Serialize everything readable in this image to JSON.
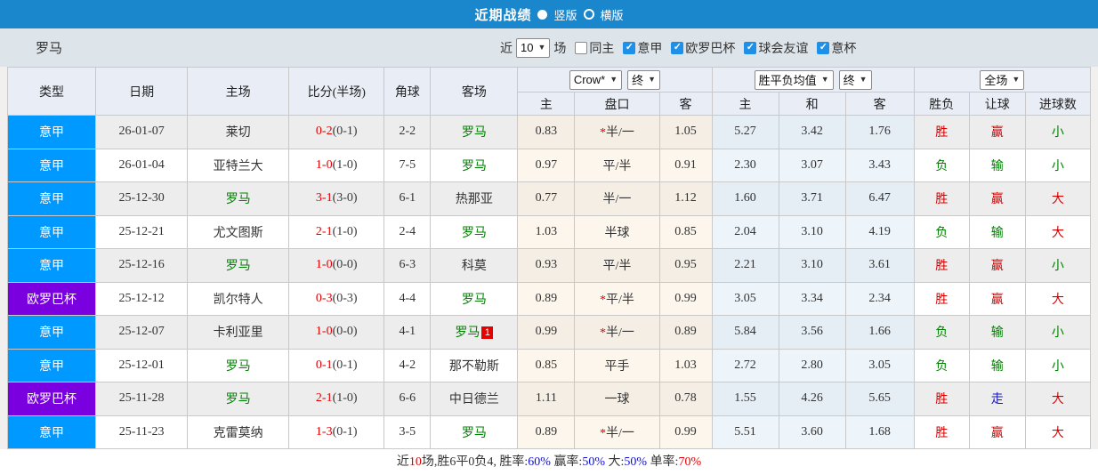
{
  "topbar": {
    "title": "近期战绩",
    "vertical_label": "竖版",
    "horizontal_label": "横版"
  },
  "filter": {
    "team": "罗马",
    "recent_label": "近",
    "count": "10",
    "matches_label": "场",
    "same_home_label": "同主",
    "leagues": [
      "意甲",
      "欧罗巴杯",
      "球会友谊",
      "意杯"
    ]
  },
  "table": {
    "selects": {
      "bookmaker": "Crow*",
      "final_left": "终",
      "avg": "胜平负均值",
      "final_mid": "终",
      "scope": "全场"
    },
    "header_left": [
      "类型",
      "日期",
      "主场",
      "比分(半场)",
      "角球",
      "客场"
    ],
    "header_sub": [
      "主",
      "盘口",
      "客",
      "主",
      "和",
      "客",
      "胜负",
      "让球",
      "进球数"
    ],
    "rows": [
      {
        "comp": "意甲",
        "date": "26-01-07",
        "home": "莱切",
        "score_ft": "0-2",
        "score_ht": "(0-1)",
        "corners": "2-2",
        "away": "罗马",
        "odds_home": "0.83",
        "handicap": "*半/一",
        "odds_away": "1.05",
        "avg_home": "5.27",
        "avg_draw": "3.42",
        "avg_away": "1.76",
        "res_wl": "胜",
        "res_handicap": "赢",
        "res_goals": "小"
      },
      {
        "comp": "意甲",
        "date": "26-01-04",
        "home": "亚特兰大",
        "score_ft": "1-0",
        "score_ht": "(1-0)",
        "corners": "7-5",
        "away": "罗马",
        "odds_home": "0.97",
        "handicap": "平/半",
        "odds_away": "0.91",
        "avg_home": "2.30",
        "avg_draw": "3.07",
        "avg_away": "3.43",
        "res_wl": "负",
        "res_handicap": "输",
        "res_goals": "小"
      },
      {
        "comp": "意甲",
        "date": "25-12-30",
        "home": "罗马",
        "score_ft": "3-1",
        "score_ht": "(3-0)",
        "corners": "6-1",
        "away": "热那亚",
        "odds_home": "0.77",
        "handicap": "半/一",
        "odds_away": "1.12",
        "avg_home": "1.60",
        "avg_draw": "3.71",
        "avg_away": "6.47",
        "res_wl": "胜",
        "res_handicap": "赢",
        "res_goals": "大"
      },
      {
        "comp": "意甲",
        "date": "25-12-21",
        "home": "尤文图斯",
        "score_ft": "2-1",
        "score_ht": "(1-0)",
        "corners": "2-4",
        "away": "罗马",
        "odds_home": "1.03",
        "handicap": "半球",
        "odds_away": "0.85",
        "avg_home": "2.04",
        "avg_draw": "3.10",
        "avg_away": "4.19",
        "res_wl": "负",
        "res_handicap": "输",
        "res_goals": "大"
      },
      {
        "comp": "意甲",
        "date": "25-12-16",
        "home": "罗马",
        "score_ft": "1-0",
        "score_ht": "(0-0)",
        "corners": "6-3",
        "away": "科莫",
        "odds_home": "0.93",
        "handicap": "平/半",
        "odds_away": "0.95",
        "avg_home": "2.21",
        "avg_draw": "3.10",
        "avg_away": "3.61",
        "res_wl": "胜",
        "res_handicap": "赢",
        "res_goals": "小"
      },
      {
        "comp": "欧罗巴杯",
        "date": "25-12-12",
        "home": "凯尔特人",
        "score_ft": "0-3",
        "score_ht": "(0-3)",
        "corners": "4-4",
        "away": "罗马",
        "odds_home": "0.89",
        "handicap": "*平/半",
        "odds_away": "0.99",
        "avg_home": "3.05",
        "avg_draw": "3.34",
        "avg_away": "2.34",
        "res_wl": "胜",
        "res_handicap": "赢",
        "res_goals": "大"
      },
      {
        "comp": "意甲",
        "date": "25-12-07",
        "home": "卡利亚里",
        "score_ft": "1-0",
        "score_ht": "(0-0)",
        "corners": "4-1",
        "away": "罗马",
        "away_card": "1",
        "odds_home": "0.99",
        "handicap": "*半/一",
        "odds_away": "0.89",
        "avg_home": "5.84",
        "avg_draw": "3.56",
        "avg_away": "1.66",
        "res_wl": "负",
        "res_handicap": "输",
        "res_goals": "小"
      },
      {
        "comp": "意甲",
        "date": "25-12-01",
        "home": "罗马",
        "score_ft": "0-1",
        "score_ht": "(0-1)",
        "corners": "4-2",
        "away": "那不勒斯",
        "odds_home": "0.85",
        "handicap": "平手",
        "odds_away": "1.03",
        "avg_home": "2.72",
        "avg_draw": "2.80",
        "avg_away": "3.05",
        "res_wl": "负",
        "res_handicap": "输",
        "res_goals": "小"
      },
      {
        "comp": "欧罗巴杯",
        "date": "25-11-28",
        "home": "罗马",
        "score_ft": "2-1",
        "score_ht": "(1-0)",
        "corners": "6-6",
        "away": "中日德兰",
        "odds_home": "1.11",
        "handicap": "一球",
        "odds_away": "0.78",
        "avg_home": "1.55",
        "avg_draw": "4.26",
        "avg_away": "5.65",
        "res_wl": "胜",
        "res_handicap": "走",
        "res_goals": "大"
      },
      {
        "comp": "意甲",
        "date": "25-11-23",
        "home": "克雷莫纳",
        "score_ft": "1-3",
        "score_ht": "(0-1)",
        "corners": "3-5",
        "away": "罗马",
        "odds_home": "0.89",
        "handicap": "*半/一",
        "odds_away": "0.99",
        "avg_home": "5.51",
        "avg_draw": "3.60",
        "avg_away": "1.68",
        "res_wl": "胜",
        "res_handicap": "赢",
        "res_goals": "大"
      }
    ]
  },
  "result_classes": {
    "胜": "win",
    "负": "lose",
    "赢": "win",
    "输": "lose",
    "走": "draw",
    "大": "win",
    "小": "lose"
  },
  "summary": {
    "p1": "近",
    "count": "10",
    "p2": "场,胜6平0负4, 胜率:",
    "win_rate": "60%",
    "p3": " 赢率:",
    "handicap_rate": "50%",
    "p4": " 大:",
    "big_rate": "50%",
    "p5": " 单率:",
    "single_rate": "70%"
  },
  "colors": {
    "topbar_blue": "#1a87cc",
    "filter_bg": "#dde4ea",
    "header_bg": "#e9eef6",
    "border_gray": "#c9c9c9",
    "zebra_gray": "#ededed",
    "league_italy": "#0099ff",
    "league_europa": "#7a00e0",
    "team_green": "#008000",
    "score_red": "#e60000",
    "star_red": "#e60000",
    "win_red": "#d40000",
    "lose_green": "#008000",
    "draw_blue": "#1818c8",
    "rate_blue": "#1010d0",
    "rate_red": "#e00000",
    "checkbox_blue": "#1e90e8",
    "odds_cream": "#fcf6ed",
    "odds_cream_alt": "#f4eee5",
    "avg_blue": "#edf5fb",
    "avg_blue_alt": "#e6eef5"
  }
}
